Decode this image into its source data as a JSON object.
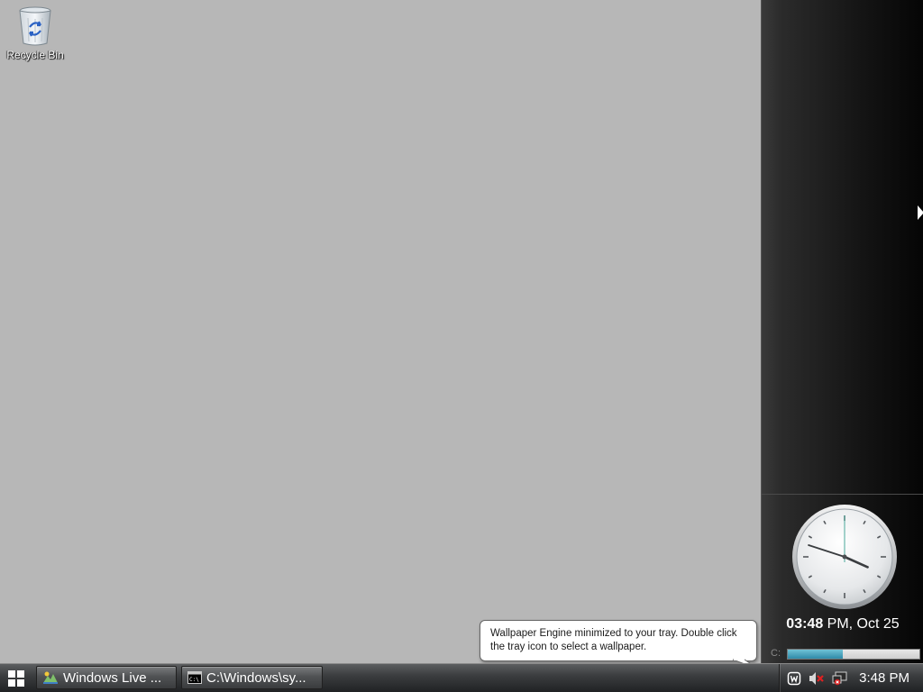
{
  "desktop": {
    "background": "#b7b7b7",
    "icons": [
      {
        "label": "Recycle Bin",
        "icon": "recycle-bin-icon"
      }
    ]
  },
  "sidebar": {
    "clock": {
      "hour": 3,
      "minute": 48,
      "time_text": "03:48",
      "date_text": " PM, Oct 25"
    },
    "drive_meter": {
      "label": "C:",
      "used_fraction": 0.42,
      "color": "#2f8aa8"
    }
  },
  "balloon": {
    "line1": "Wallpaper Engine minimized to your tray. Double click",
    "line2": "the tray icon to select a wallpaper."
  },
  "taskbar": {
    "start_icon": "windows-logo-icon",
    "buttons": [
      {
        "label": "Windows Live ...",
        "icon": "windows-live-icon"
      },
      {
        "label": "C:\\Windows\\sy...",
        "icon": "command-prompt-icon"
      }
    ],
    "tray": {
      "icons": [
        "wallpaper-engine-icon",
        "speaker-muted-icon",
        "network-error-icon"
      ],
      "time": "3:48 PM"
    }
  }
}
